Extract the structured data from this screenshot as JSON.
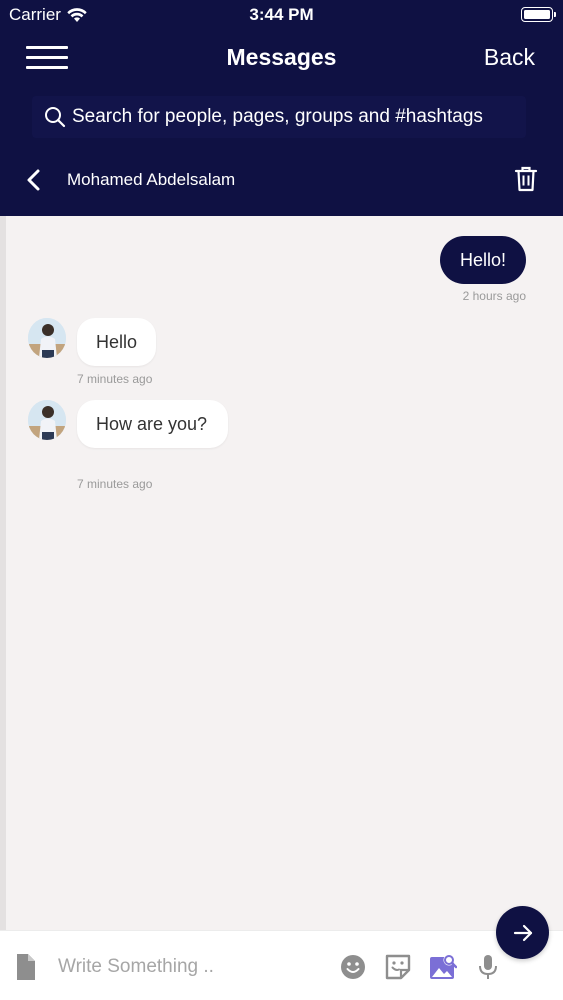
{
  "status_bar": {
    "carrier": "Carrier",
    "time": "3:44 PM"
  },
  "nav": {
    "title": "Messages",
    "back_label": "Back"
  },
  "search": {
    "placeholder": "Search for people, pages, groups and #hashtags"
  },
  "conversation": {
    "contact_name": "Mohamed Abdelsalam"
  },
  "messages": [
    {
      "direction": "outgoing",
      "text": "Hello!",
      "time": "2 hours ago"
    },
    {
      "direction": "incoming",
      "text": "Hello",
      "time": "7 minutes ago"
    },
    {
      "direction": "incoming",
      "text": "How are you?",
      "time": "7 minutes ago"
    }
  ],
  "composer": {
    "placeholder": "Write Something .."
  },
  "colors": {
    "primary": "#0f1143",
    "background": "#f5f2f2",
    "accent_purple": "#7b6fd6",
    "icon_gray": "#8e8e8e"
  },
  "icons": [
    "menu-icon",
    "search-icon",
    "chevron-left-icon",
    "trash-icon",
    "file-icon",
    "emoji-icon",
    "sticker-icon",
    "image-icon",
    "microphone-icon",
    "arrow-right-icon",
    "wifi-icon",
    "battery-icon"
  ]
}
